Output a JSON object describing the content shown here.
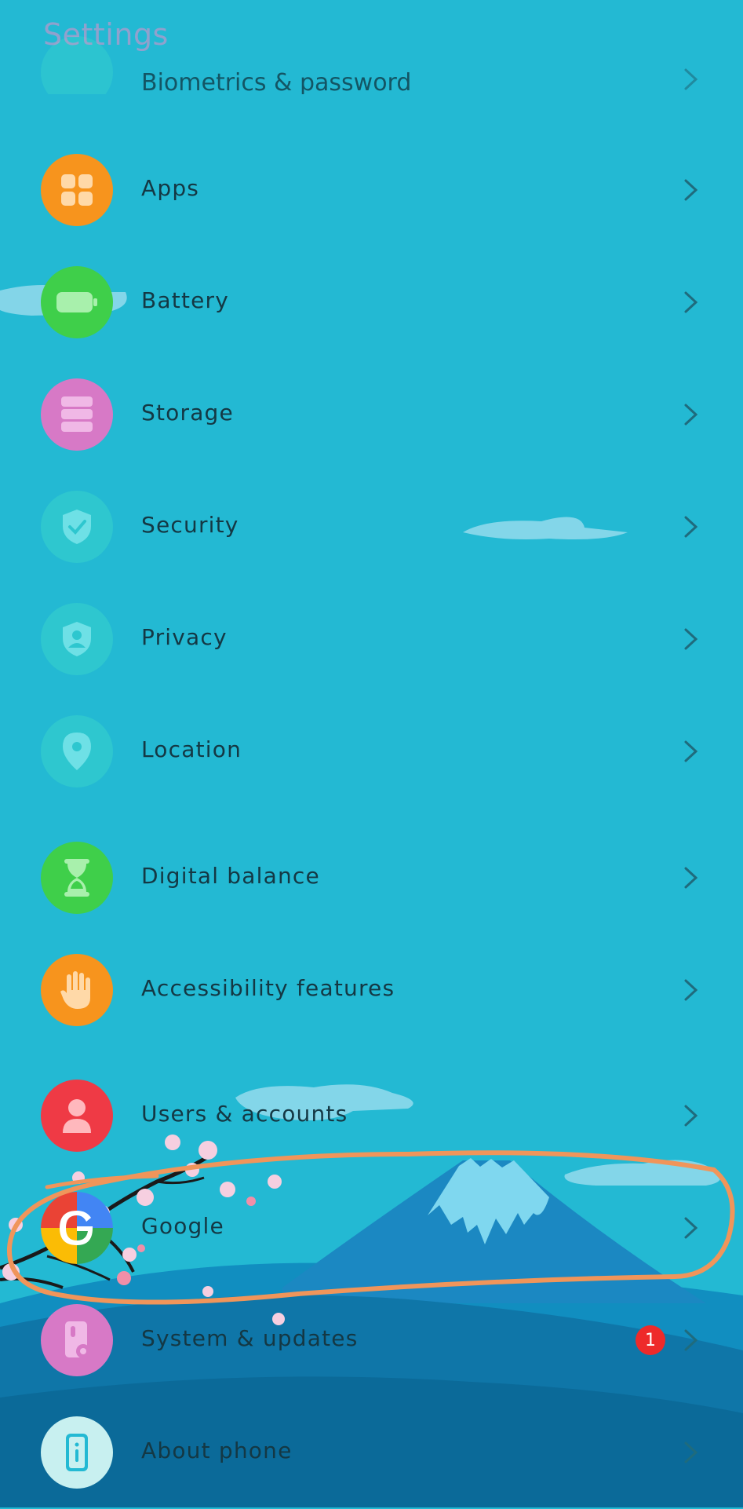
{
  "header": {
    "title": "Settings"
  },
  "partial_item": {
    "label": "Biometrics & password"
  },
  "items": [
    {
      "label": "Apps",
      "icon": "apps-icon",
      "color": "#f7941d"
    },
    {
      "label": "Battery",
      "icon": "battery-icon",
      "color": "#3fcf4a"
    },
    {
      "label": "Storage",
      "icon": "storage-icon",
      "color": "#d779c6"
    },
    {
      "label": "Security",
      "icon": "shield-icon",
      "color": "#2ec7cf"
    },
    {
      "label": "Privacy",
      "icon": "privacy-icon",
      "color": "#2ec7cf"
    },
    {
      "label": "Location",
      "icon": "location-pin-icon",
      "color": "#2ec7cf"
    },
    {
      "label": "Digital balance",
      "icon": "hourglass-icon",
      "color": "#3fcf4a"
    },
    {
      "label": "Accessibility features",
      "icon": "hand-icon",
      "color": "#f7941d"
    },
    {
      "label": "Users & accounts",
      "icon": "user-icon",
      "color": "#ef3a45"
    },
    {
      "label": "Google",
      "icon": "google-icon",
      "color": "#ffffff"
    },
    {
      "label": "System & updates",
      "icon": "phone-settings-icon",
      "color": "#d779c6",
      "badge": "1"
    },
    {
      "label": "About phone",
      "icon": "info-phone-icon",
      "color": "#c8f0f0"
    }
  ],
  "colors": {
    "background": "#23b9d3",
    "annotation": "#f0955a",
    "badge": "#ee2a2a"
  }
}
